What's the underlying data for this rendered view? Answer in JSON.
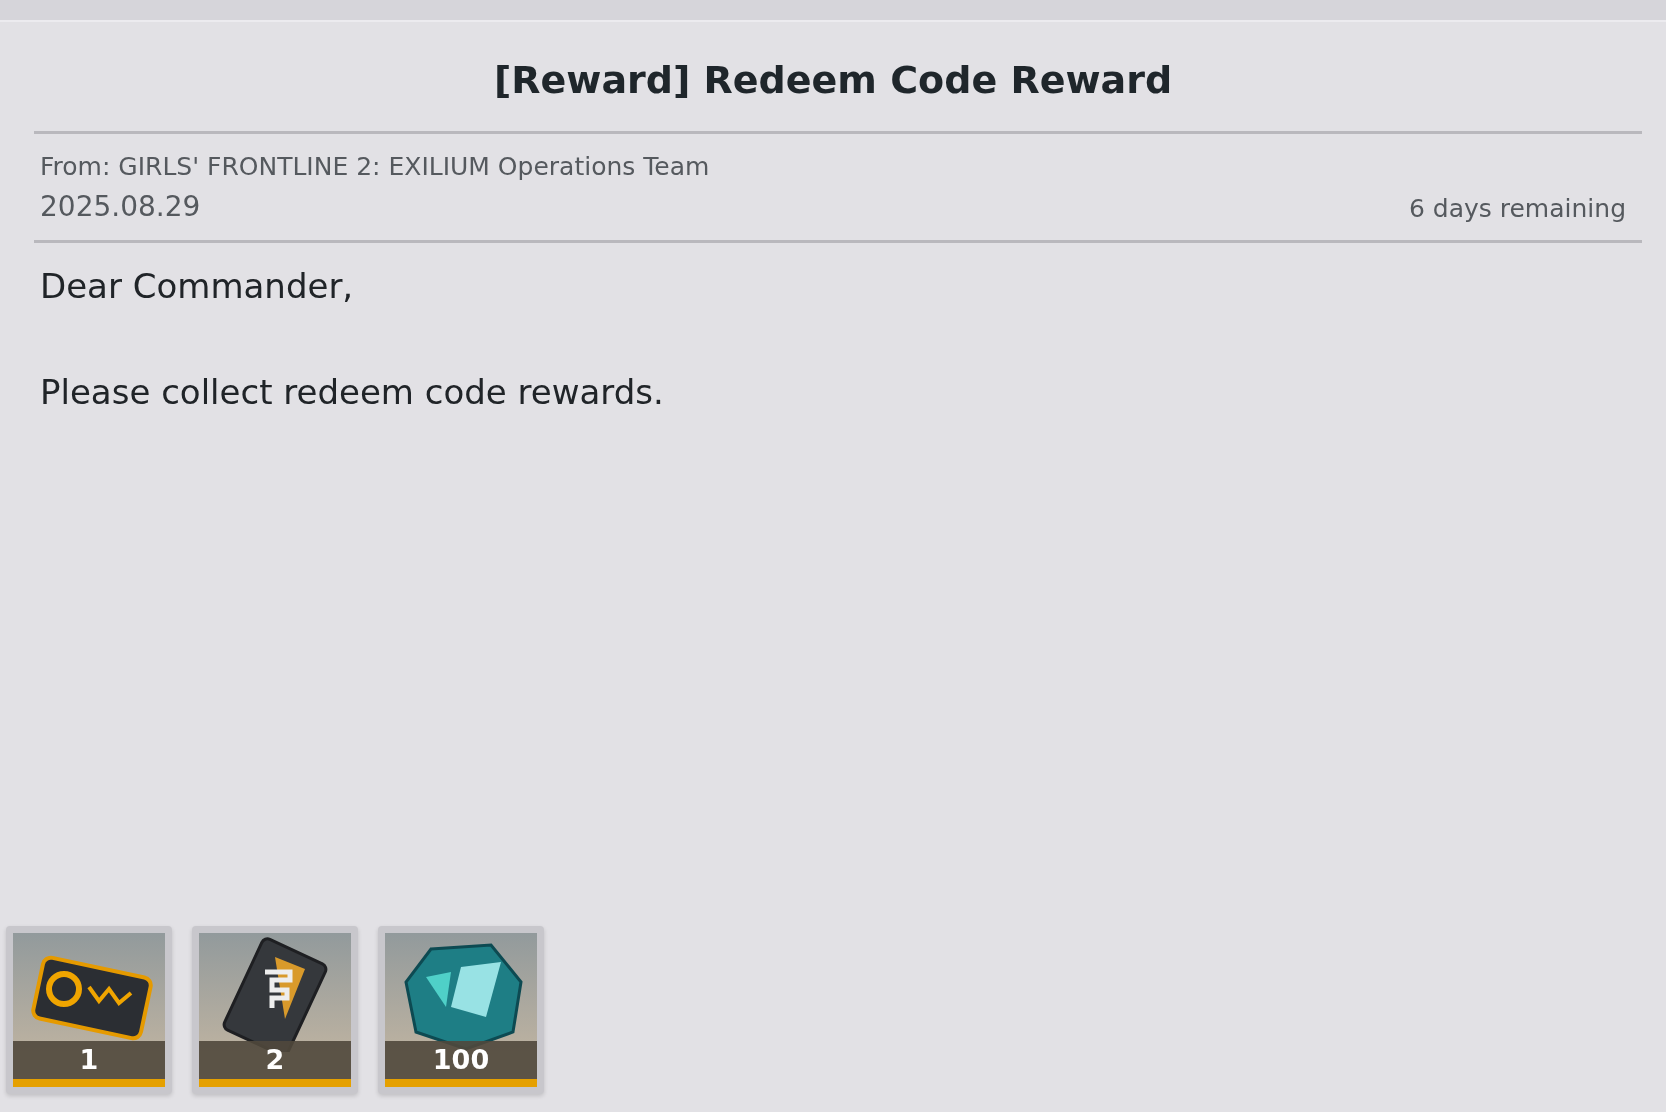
{
  "title": "[Reward] Redeem Code Reward",
  "sender": "From: GIRLS' FRONTLINE 2: EXILIUM Operations Team",
  "date": "2025.08.29",
  "remaining": "6 days remaining",
  "body": [
    "Dear Commander,",
    "Please collect redeem code rewards."
  ],
  "rewards": [
    {
      "kind": "card",
      "count": "1"
    },
    {
      "kind": "case",
      "count": "2"
    },
    {
      "kind": "crystal",
      "count": "100"
    }
  ]
}
